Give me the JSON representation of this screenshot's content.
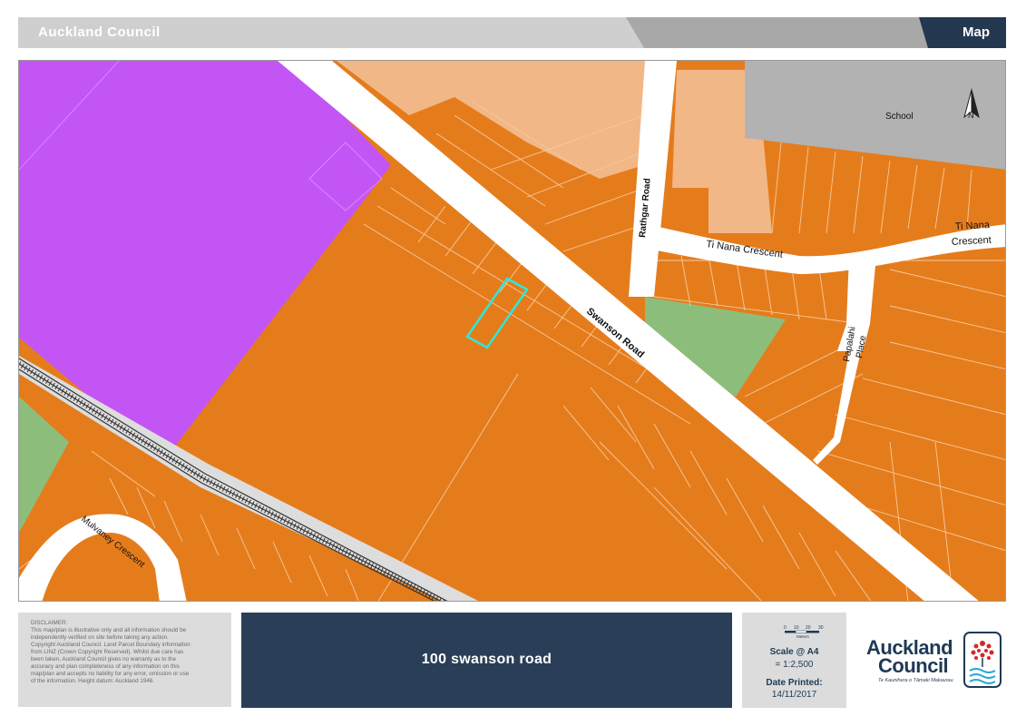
{
  "header": {
    "org": "Auckland Council",
    "tab": "Map"
  },
  "map": {
    "north_label": "N",
    "labels": {
      "school": "School",
      "swanson_road": "Swanson Road",
      "rathgar_road": "Rathgar Road",
      "ti_nana_crescent_1": "Ti Nana Crescent",
      "ti_nana_crescent_2a": "Ti Nana",
      "ti_nana_crescent_2b": "Crescent",
      "papalahi_place_a": "Papalahi",
      "papalahi_place_b": "Place",
      "mulvaney_crescent": "Mulvaney Crescent"
    },
    "colors": {
      "residential": "#e57c1c",
      "residential_light": "#f2b787",
      "special_purpose": "#c455f5",
      "open_space": "#8dbd7a",
      "school": "#b2b2b2",
      "road": "#ffffff",
      "selected_parcel": "#2ee8d8",
      "rail": "#333333"
    }
  },
  "footer": {
    "disclaimer_lines": [
      "DISCLAIMER:",
      "This map/plan is illustrative only and all information should be",
      "independently verified on site before taking any action.",
      "Copyright Auckland Council. Land Parcel Boundary information",
      "from LINZ (Crown Copyright Reserved). Whilst due care has",
      "been taken, Auckland Council gives no warranty as to the",
      "accuracy and plan completeness of any information on this",
      "map/plan and accepts no liability for any error, omission or use",
      "of the information. Height datum: Auckland 1946."
    ],
    "title": "100 swanson road",
    "scale": {
      "ticks": [
        "0",
        "10",
        "20",
        "30"
      ],
      "unit": "Meters",
      "label": "Scale @ A4",
      "value": "= 1:2,500"
    },
    "date": {
      "label": "Date Printed:",
      "value": "14/11/2017"
    },
    "logo": {
      "word1": "Auckland",
      "word2": "Council",
      "tagline": "Te Kaunihera o Tāmaki Makaurau"
    }
  }
}
